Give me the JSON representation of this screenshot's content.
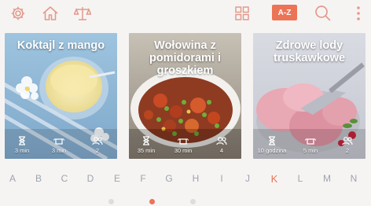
{
  "toolbar": {
    "sort_label": "A-Z",
    "icons": [
      "gear-icon",
      "home-icon",
      "scale-icon",
      "grid-icon",
      "search-icon",
      "more-icon"
    ]
  },
  "cards": [
    {
      "title": "Koktajl z mango",
      "prep": "3 min",
      "cook": "3 min",
      "servings": "2"
    },
    {
      "title": "Wołowina z pomidorami i groszkiem",
      "prep": "35 min",
      "cook": "30 min",
      "servings": "4"
    },
    {
      "title": "Zdrowe lody truskawkowe",
      "prep": "10 godzina",
      "cook": "5 min",
      "servings": "2"
    }
  ],
  "alphabet": [
    "A",
    "B",
    "C",
    "D",
    "E",
    "F",
    "G",
    "H",
    "I",
    "J",
    "K",
    "L",
    "M",
    "N"
  ],
  "alphabet_active": "K",
  "pager": {
    "active": 1,
    "total": 3
  },
  "colors": {
    "accent": "#ec7456",
    "icon": "#e39a8c",
    "letter": "#9ea3ab"
  }
}
